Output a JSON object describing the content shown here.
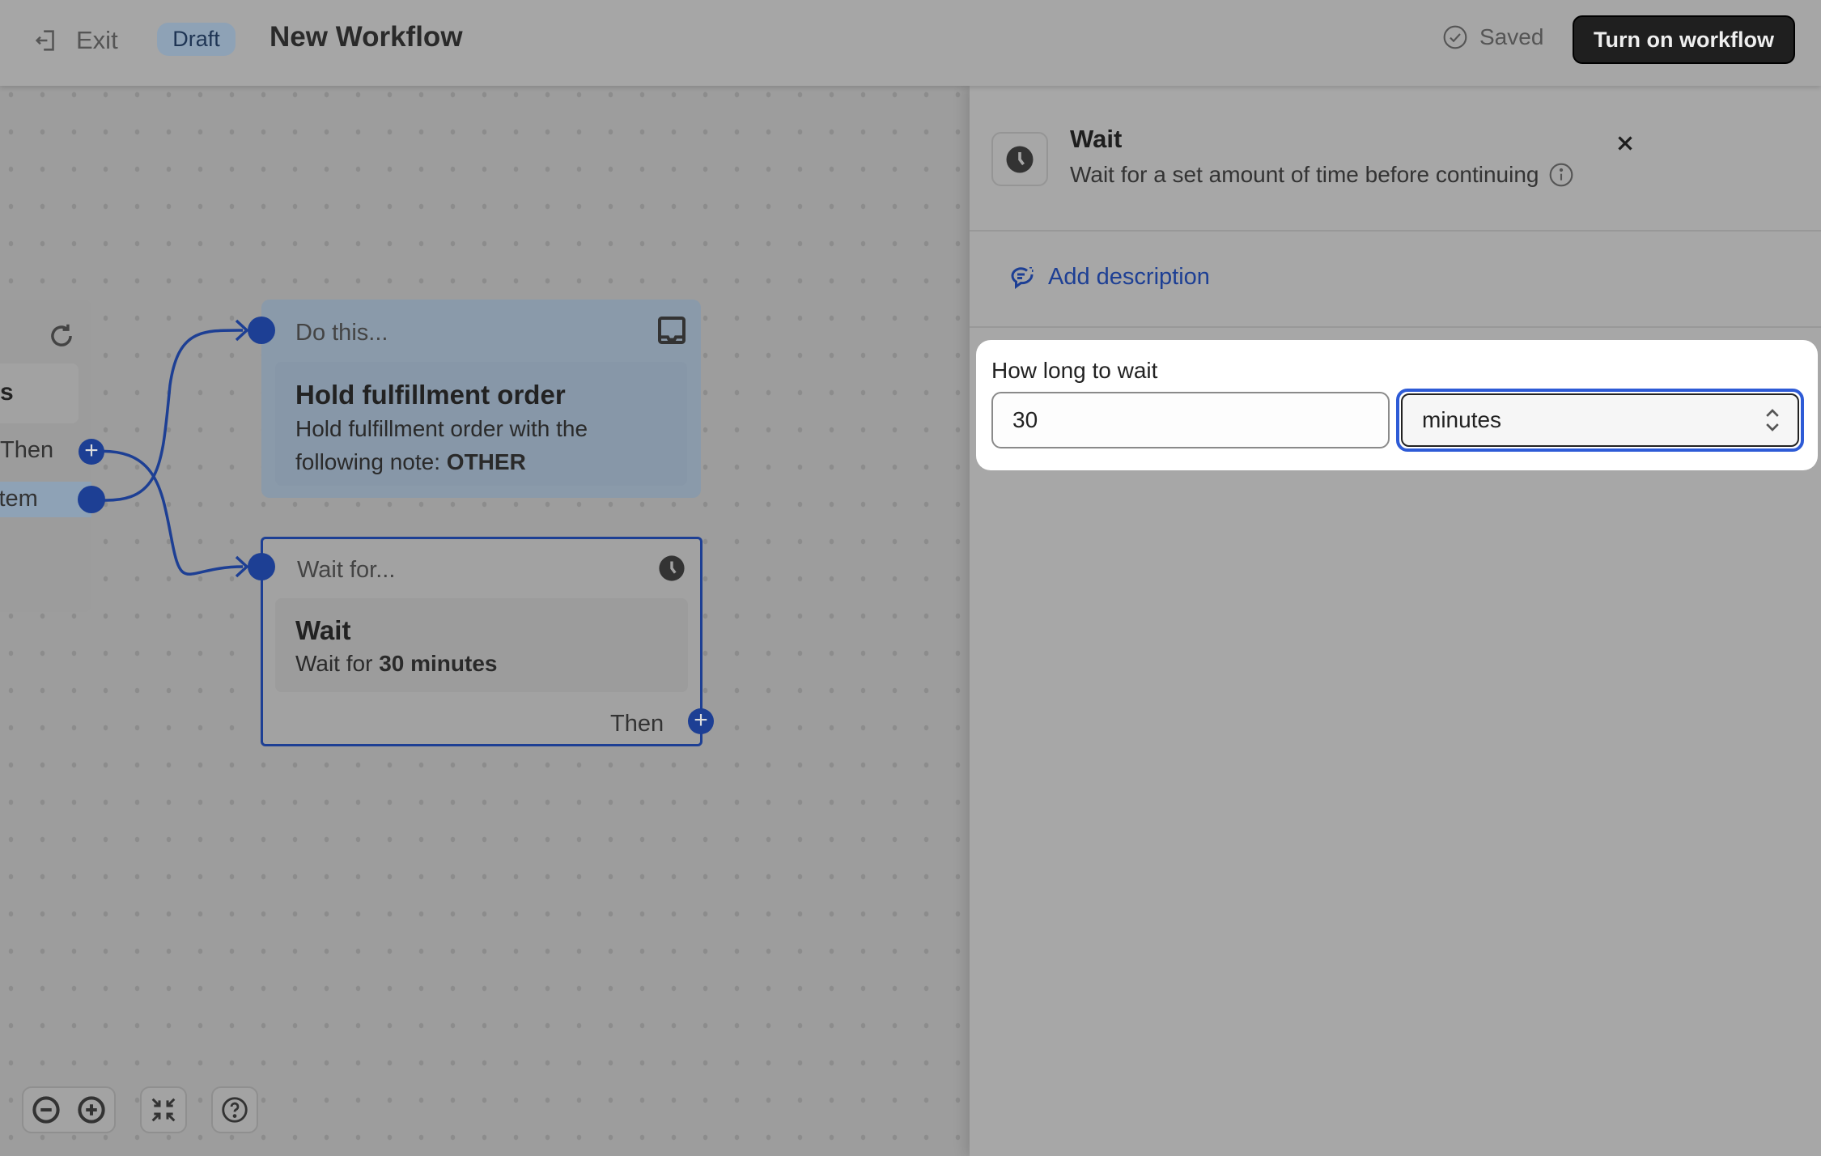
{
  "header": {
    "exit_label": "Exit",
    "status_badge": "Draft",
    "title": "New Workflow",
    "saved_label": "Saved",
    "turn_on_button": "Turn on workflow"
  },
  "canvas": {
    "partial_node": {
      "title_fragment": "s",
      "then_label": "Then",
      "item_label": "item"
    },
    "action_node": {
      "header": "Do this...",
      "title": "Hold fulfillment order",
      "desc_line1": "Hold fulfillment order with the",
      "desc_prefix": "following note: ",
      "desc_bold": "OTHER",
      "icon": "inbox-icon"
    },
    "wait_node": {
      "header": "Wait for...",
      "title": "Wait",
      "desc_prefix": "Wait for ",
      "desc_bold": "30 minutes",
      "then_label": "Then",
      "icon": "clock-icon"
    },
    "toolbar": [
      "zoom-out-icon",
      "zoom-in-icon",
      "fit-view-icon",
      "help-icon"
    ]
  },
  "panel": {
    "title": "Wait",
    "subtitle": "Wait for a set amount of time before continuing",
    "add_description": "Add description",
    "field_label": "How long to wait",
    "amount_value": "30",
    "unit_value": "minutes"
  },
  "colors": {
    "accent_blue": "#1d3f94",
    "primary_button": "#1f1f1f",
    "draft_badge": "#8ea2b6"
  }
}
